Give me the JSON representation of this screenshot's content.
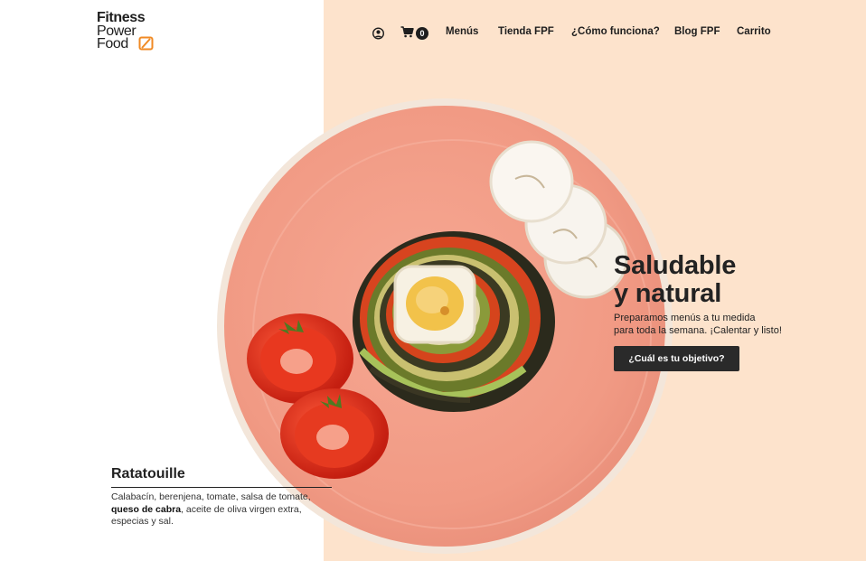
{
  "brand": {
    "logo_line1": "Fitness",
    "logo_line2": "Power",
    "logo_line3": "Food",
    "accent_color": "#f08a24"
  },
  "nav": {
    "user_icon": "user-icon",
    "cart_icon": "cart-icon",
    "cart_count": "0",
    "links": [
      "Menús",
      "Tienda FPF",
      "¿Cómo funciona?",
      "Blog FPF",
      "Carrito"
    ]
  },
  "hero": {
    "title_line1": "Saludable",
    "title_line2": "y natural",
    "subtitle_line1": "Preparamos menús a tu medida",
    "subtitle_line2": "para toda la semana. ¡Calentar y listo!",
    "cta_label": "¿Cuál es tu objetivo?"
  },
  "dish": {
    "name": "Ratatouille",
    "desc_part1": "Calabacín, berenjena, tomate, salsa de tomate,",
    "desc_bold": "queso de cabra",
    "desc_part2": ", aceite de oliva virgen extra,",
    "desc_part3": "especias y sal."
  },
  "colors": {
    "panel_bg": "#fde3cc",
    "plate": "#f4a08c",
    "dark": "#2a2a2a"
  }
}
